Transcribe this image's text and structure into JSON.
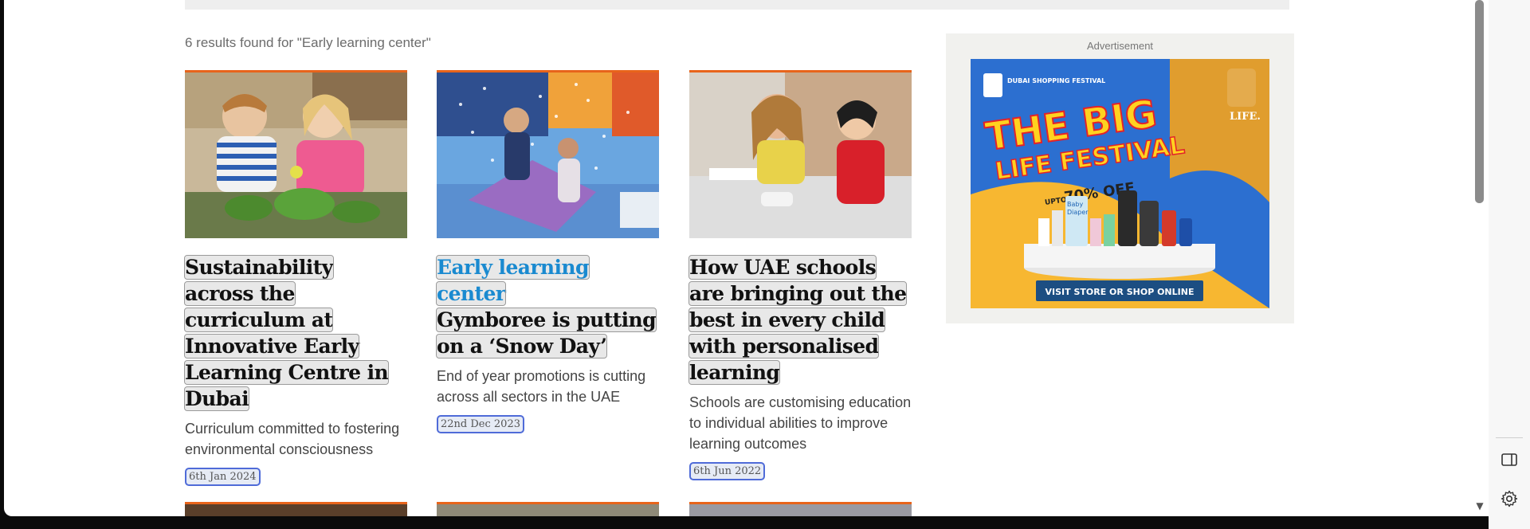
{
  "search": {
    "results_text": "6 results found for \"Early learning center\""
  },
  "articles": [
    {
      "title_parts": [
        "Sustainability across the curriculum at Innovative Early Learning Centre in Dubai"
      ],
      "summary": "Curriculum committed to fostering environmental consciousness",
      "date": "6th Jan 2024",
      "image": "children-gardening-photo"
    },
    {
      "title_highlight": "Early learning center",
      "title_rest": "Gymboree is putting on a ‘Snow Day’",
      "summary": "End of year promotions is cutting across all sectors in the UAE",
      "date": "22nd Dec 2023",
      "image": "children-snow-play-photo"
    },
    {
      "title_parts": [
        "How UAE schools are bringing out the best in every child with personalised learning"
      ],
      "summary": "Schools are customising education to individual abilities to improve learning outcomes",
      "date": "6th Jun 2022",
      "image": "teacher-with-student-photo"
    }
  ],
  "ad": {
    "label": "Advertisement",
    "logo_left": "DUBAI SHOPPING FESTIVAL",
    "logo_right": "LIFE.",
    "headline_1": "THE BIG",
    "headline_2": "LIFE FESTIVAL",
    "discount_prefix": "UPTO",
    "discount": "70% OFF",
    "product_tag_1": "Baby",
    "product_tag_2": "Diaper",
    "cta": "VISIT STORE OR SHOP ONLINE"
  },
  "colors": {
    "accent_orange": "#e8641b",
    "link_blue": "#1a8ad0",
    "badge_border": "#4f6bd8",
    "ad_blue": "#2c6fd0",
    "ad_yellow": "#f7b731",
    "ad_red": "#e3222a"
  },
  "icons": {
    "scroll_down": "scroll-down-arrow-icon",
    "sidebar_toggle": "sidebar-panel-icon",
    "settings": "gear-icon"
  }
}
